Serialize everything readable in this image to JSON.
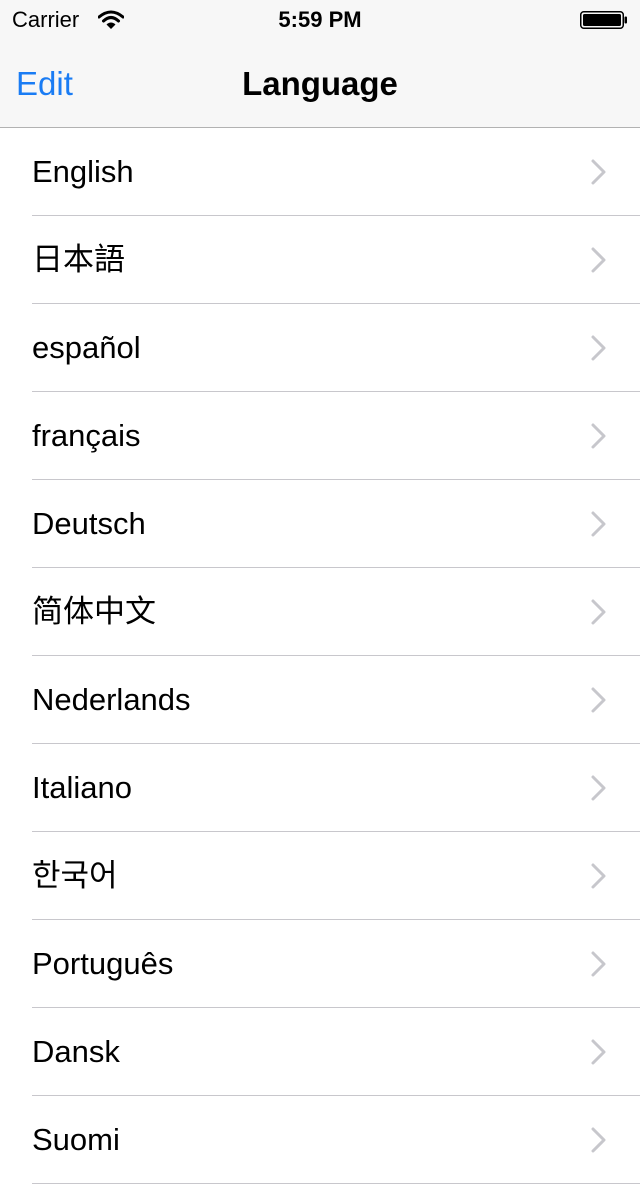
{
  "status_bar": {
    "carrier": "Carrier",
    "time": "5:59 PM",
    "icons": [
      "wifi-icon",
      "battery-icon"
    ]
  },
  "nav_bar": {
    "edit_label": "Edit",
    "title": "Language"
  },
  "colors": {
    "accent": "#1a7cf4",
    "separator": "#c8c7cc",
    "chevron": "#c7c7cc",
    "bar_background": "#f7f7f7"
  },
  "languages": [
    "English",
    "日本語",
    "español",
    "français",
    "Deutsch",
    "简体中文",
    "Nederlands",
    "Italiano",
    "한국어",
    "Português",
    "Dansk",
    "Suomi"
  ]
}
